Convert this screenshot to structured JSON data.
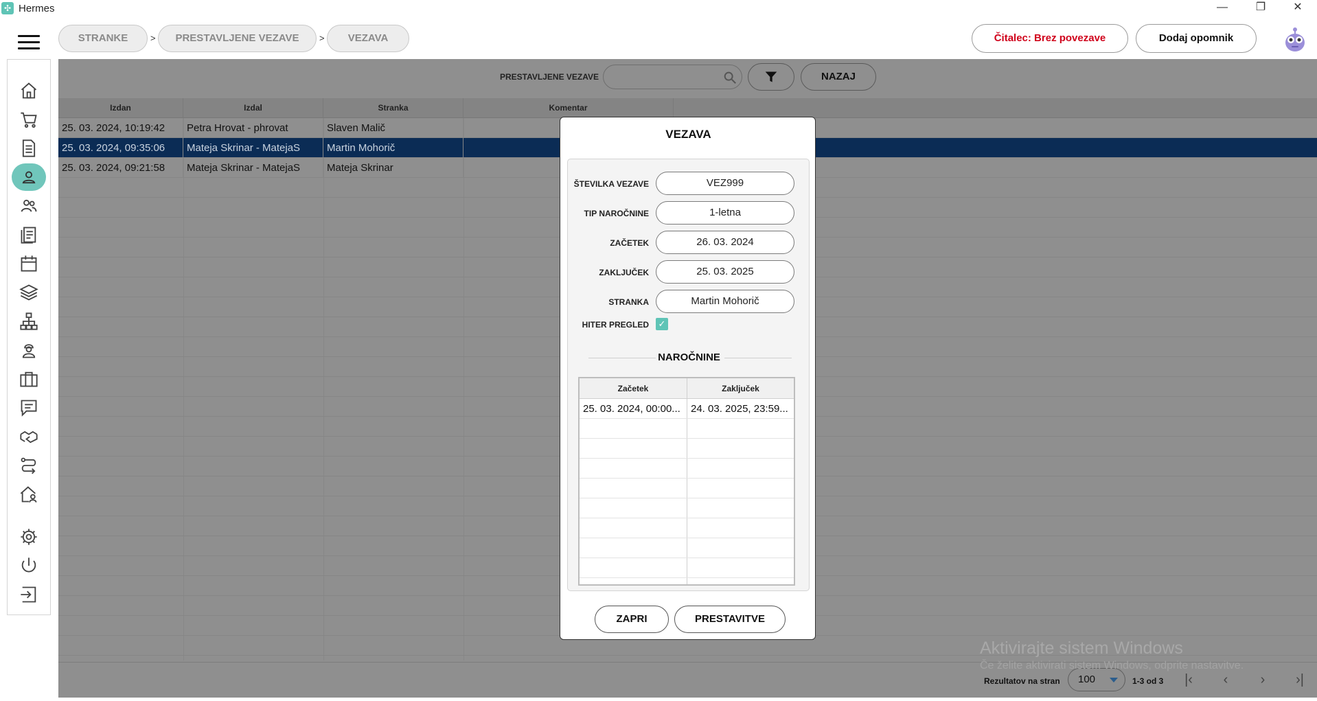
{
  "window": {
    "title": "Hermes",
    "minimize": "—",
    "restore": "❐",
    "close": "✕"
  },
  "breadcrumbs": [
    {
      "label": "STRANKE"
    },
    {
      "label": "PRESTAVLJENE VEZAVE"
    },
    {
      "label": "VEZAVA"
    }
  ],
  "breadcrumb_separator": ">",
  "header": {
    "reader_status": "Čitalec: Brez povezave",
    "reader_status_color": "#d0021b",
    "add_reminder": "Dodaj opomnik"
  },
  "sidebar": {
    "accent": "#70c6bb",
    "items": [
      {
        "icon": "home-icon"
      },
      {
        "icon": "cart-icon"
      },
      {
        "icon": "document-icon"
      },
      {
        "icon": "user-icon",
        "active": true
      },
      {
        "icon": "users-icon"
      },
      {
        "icon": "list-document-icon"
      },
      {
        "icon": "calendar-icon"
      },
      {
        "icon": "layers-icon"
      },
      {
        "icon": "network-icon"
      },
      {
        "icon": "worker-icon"
      },
      {
        "icon": "briefcase-icon"
      },
      {
        "icon": "chat-icon"
      },
      {
        "icon": "handshake-icon"
      },
      {
        "icon": "route-icon"
      },
      {
        "icon": "house-user-icon"
      },
      {
        "icon": "gear-icon"
      },
      {
        "icon": "power-icon"
      },
      {
        "icon": "logout-icon"
      }
    ]
  },
  "toolbar": {
    "label": "PRESTAVLJENE VEZAVE",
    "search_value": "",
    "back": "NAZAJ"
  },
  "table": {
    "columns": [
      "Izdan",
      "Izdal",
      "Stranka",
      "Komentar"
    ],
    "rows": [
      [
        "25. 03. 2024, 10:19:42",
        "Petra Hrovat - phrovat",
        "Slaven Malič",
        ""
      ],
      [
        "25. 03. 2024, 09:35:06",
        "Mateja Skrinar - MatejaS",
        "Martin Mohorič",
        ""
      ],
      [
        "25. 03. 2024, 09:21:58",
        "Mateja Skrinar - MatejaS",
        "Mateja Skrinar",
        ""
      ]
    ],
    "selected_row": 1,
    "selected_color": "#0b2c55"
  },
  "footer": {
    "page_size_label": "Rezultatov na stran",
    "page_size": "100",
    "range": "1-3 od 3",
    "first": "|‹",
    "prev": "‹",
    "next": "›",
    "last": "›|"
  },
  "watermark": {
    "line1": "Aktivirajte sistem Windows",
    "line2": "Če želite aktivirati sistem Windows, odprite nastavitve."
  },
  "modal": {
    "title": "VEZAVA",
    "fields": [
      {
        "label": "ŠTEVILKA VEZAVE",
        "value": "VEZ999"
      },
      {
        "label": "TIP NAROČNINE",
        "value": "1-letna"
      },
      {
        "label": "ZAČETEK",
        "value": "26. 03. 2024"
      },
      {
        "label": "ZAKLJUČEK",
        "value": "25. 03. 2025"
      },
      {
        "label": "STRANKA",
        "value": "Martin Mohorič"
      }
    ],
    "quick_view_label": "HITER PREGLED",
    "quick_view_checked": true,
    "subscriptions_title": "NAROČNINE",
    "subscriptions_columns": [
      "Začetek",
      "Zaključek"
    ],
    "subscriptions_rows": [
      [
        "25. 03. 2024, 00:00...",
        "24. 03. 2025, 23:59..."
      ]
    ],
    "close_button": "ZAPRI",
    "reschedule_button": "PRESTAVITVE"
  }
}
